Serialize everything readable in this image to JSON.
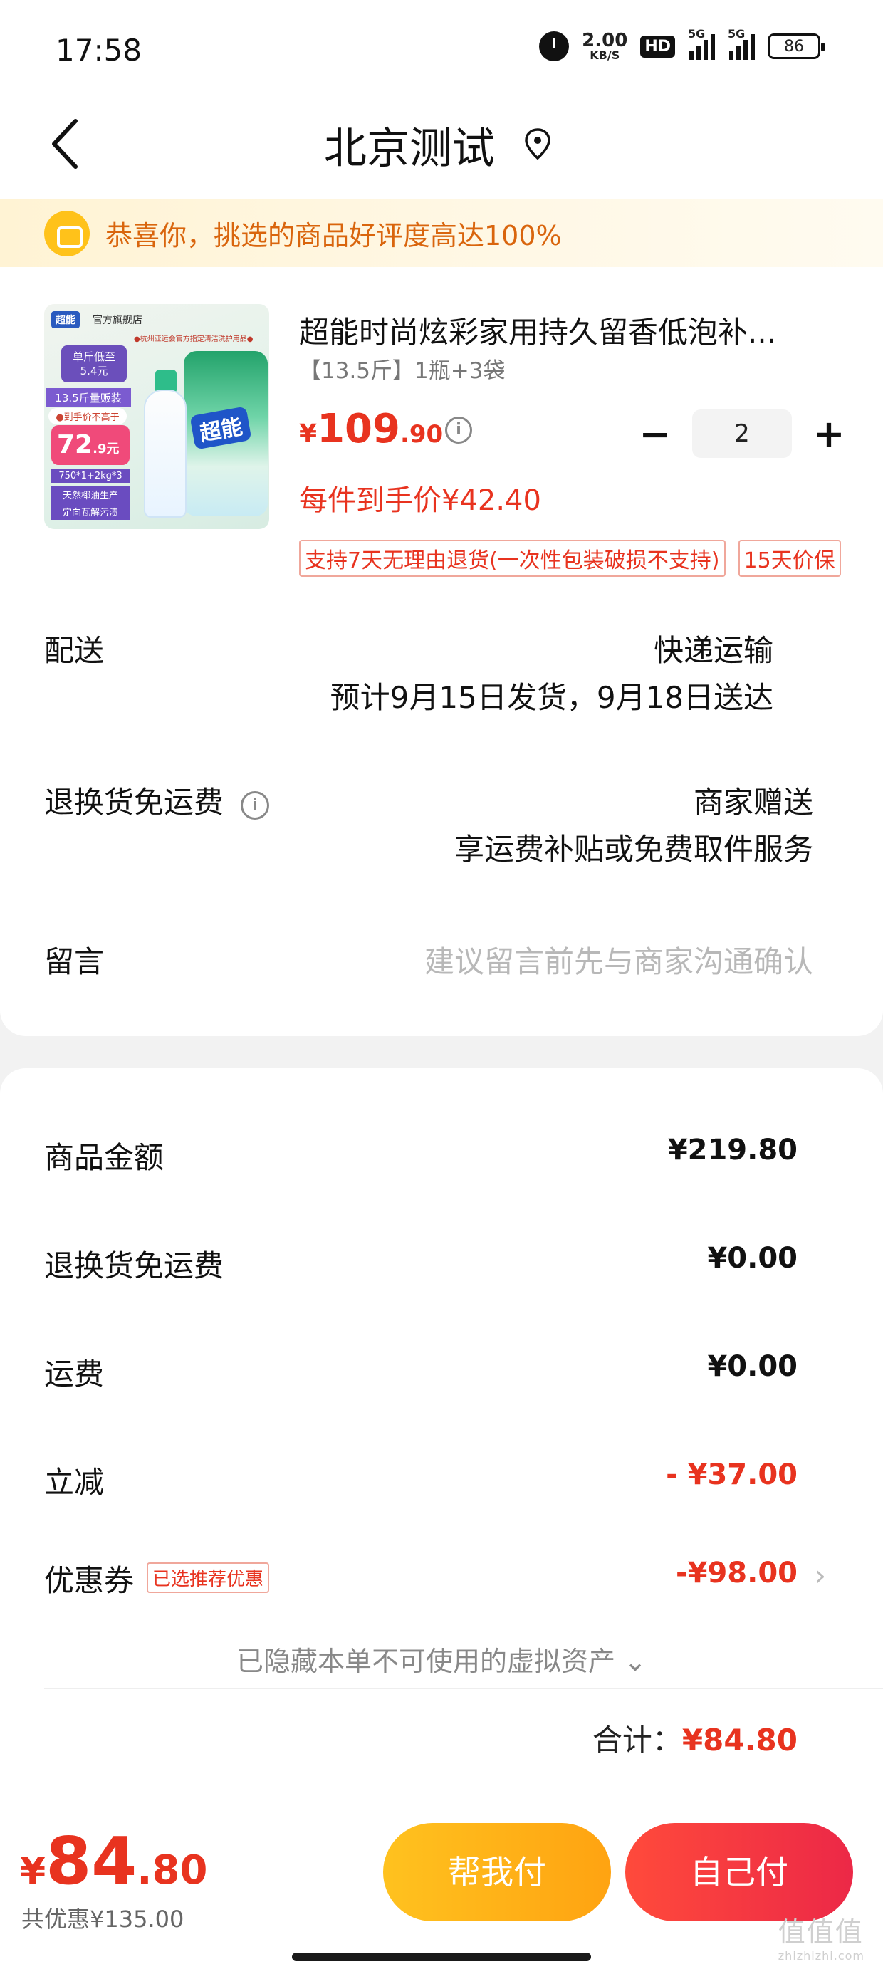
{
  "status_bar": {
    "time": "17:58",
    "net_speed": "2.00",
    "net_unit": "KB/S",
    "hd_label": "HD",
    "sim1": "5G",
    "sim2": "5G",
    "battery": "86"
  },
  "header": {
    "title": "北京测试"
  },
  "banner": {
    "text": "恭喜你，挑选的商品好评度高达100%"
  },
  "product": {
    "name": "超能时尚炫彩家用持久留香低泡补...",
    "spec": "【13.5斤】1瓶+3袋",
    "price_currency": "¥",
    "price_int": "109",
    "price_dec": ".90",
    "quantity": "2",
    "unit_price": "每件到手价¥42.40",
    "tags": [
      "支持7天无理由退货(一次性包装破损不支持)",
      "15天价保"
    ],
    "image_text": {
      "brand": "超能",
      "store": "官方旗舰店",
      "top": "●杭州亚运会官方指定清洁洗护用品●",
      "badge_line1": "单斤低至",
      "badge_line2": "5.4元",
      "mid": "13.5斤量贩装",
      "mid2": "●到手价不高于",
      "price_big": "72",
      "price_small": ".9元",
      "tag1": "750*1+2kg*3",
      "tag2": "天然椰油生产",
      "tag3": "定向瓦解污渍",
      "pouch_logo": "超能"
    }
  },
  "order_rows": {
    "delivery_label": "配送",
    "delivery_method": "快递运输",
    "delivery_eta": "预计9月15日发货，9月18日送达",
    "return_label": "退换货免运费",
    "return_value": "商家赠送",
    "return_desc": "享运费补贴或免费取件服务",
    "message_label": "留言",
    "message_placeholder": "建议留言前先与商家沟通确认"
  },
  "summary": {
    "goods_label": "商品金额",
    "goods_amount": "¥219.80",
    "return_fee_label": "退换货免运费",
    "return_fee_amount": "¥0.00",
    "shipping_label": "运费",
    "shipping_amount": "¥0.00",
    "discount_label": "立减",
    "discount_amount": "- ¥37.00",
    "coupon_label": "优惠券",
    "coupon_tag": "已选推荐优惠",
    "coupon_amount": "-¥98.00",
    "hidden_assets": "已隐藏本单不可使用的虚拟资产",
    "total_label": "合计：",
    "total_amount": "¥84.80"
  },
  "bottom_bar": {
    "price_currency": "¥",
    "price_int": "84",
    "price_dec": ".80",
    "saved": "共优惠¥135.00",
    "help_pay": "帮我付",
    "self_pay": "自己付"
  },
  "watermark": {
    "main": "值值值",
    "sub": "zhizhizhi.com"
  },
  "colors": {
    "accent_red": "#e8331f",
    "banner_orange": "#d9650d",
    "help_button": "#ffb319",
    "self_button": "#f23544"
  }
}
